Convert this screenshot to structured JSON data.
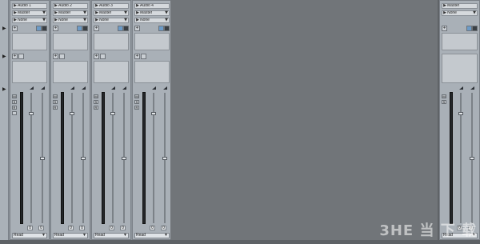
{
  "strips": [
    {
      "name": "Audio 1",
      "output": "Master",
      "input": "None",
      "auto": "Read",
      "vol_val": "0",
      "pan_val": "0"
    },
    {
      "name": "Audio 2",
      "output": "Master",
      "input": "None",
      "auto": "Read",
      "vol_val": "0",
      "pan_val": "0"
    },
    {
      "name": "Audio 3",
      "output": "Master",
      "input": "None",
      "auto": "Read",
      "vol_val": "0",
      "pan_val": "0"
    },
    {
      "name": "Audio 4",
      "output": "Master",
      "input": "None",
      "auto": "Read",
      "vol_val": "0",
      "pan_val": "0"
    }
  ],
  "master": {
    "name": "Master",
    "input": "None",
    "auto": "Read",
    "vol_val": "0",
    "pan_val": "0"
  },
  "icons": {
    "play": "▶",
    "dropdown": "▼",
    "right": "▶",
    "plus": "+",
    "mute": "M",
    "solo": "S",
    "record": "R"
  },
  "watermark": "3HE 当 下 载"
}
